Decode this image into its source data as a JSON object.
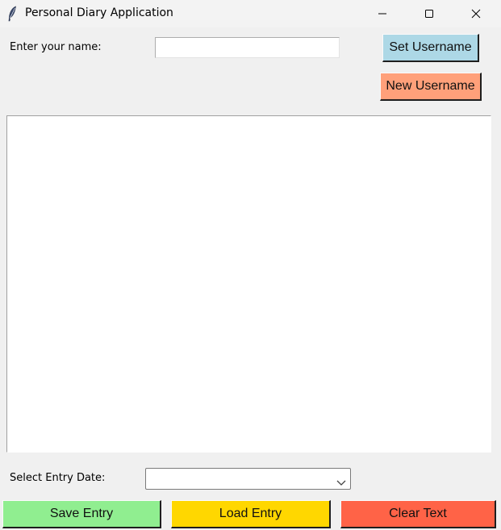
{
  "window": {
    "title": "Personal Diary Application"
  },
  "username": {
    "label": "Enter your name:",
    "value": "",
    "set_button": "Set Username",
    "new_button": "New Username",
    "set_color": "#add8e6",
    "new_color": "#ffa07a"
  },
  "diary": {
    "text": ""
  },
  "date": {
    "label": "Select Entry Date:",
    "selected": ""
  },
  "actions": {
    "save": "Save Entry",
    "load": "Load Entry",
    "clear": "Clear Text",
    "save_color": "#90ee90",
    "load_color": "#ffd700",
    "clear_color": "#ff6347"
  },
  "icons": {
    "app": "feather-icon",
    "minimize": "minimize-icon",
    "maximize": "maximize-icon",
    "close": "close-icon",
    "dropdown": "chevron-down-icon"
  }
}
